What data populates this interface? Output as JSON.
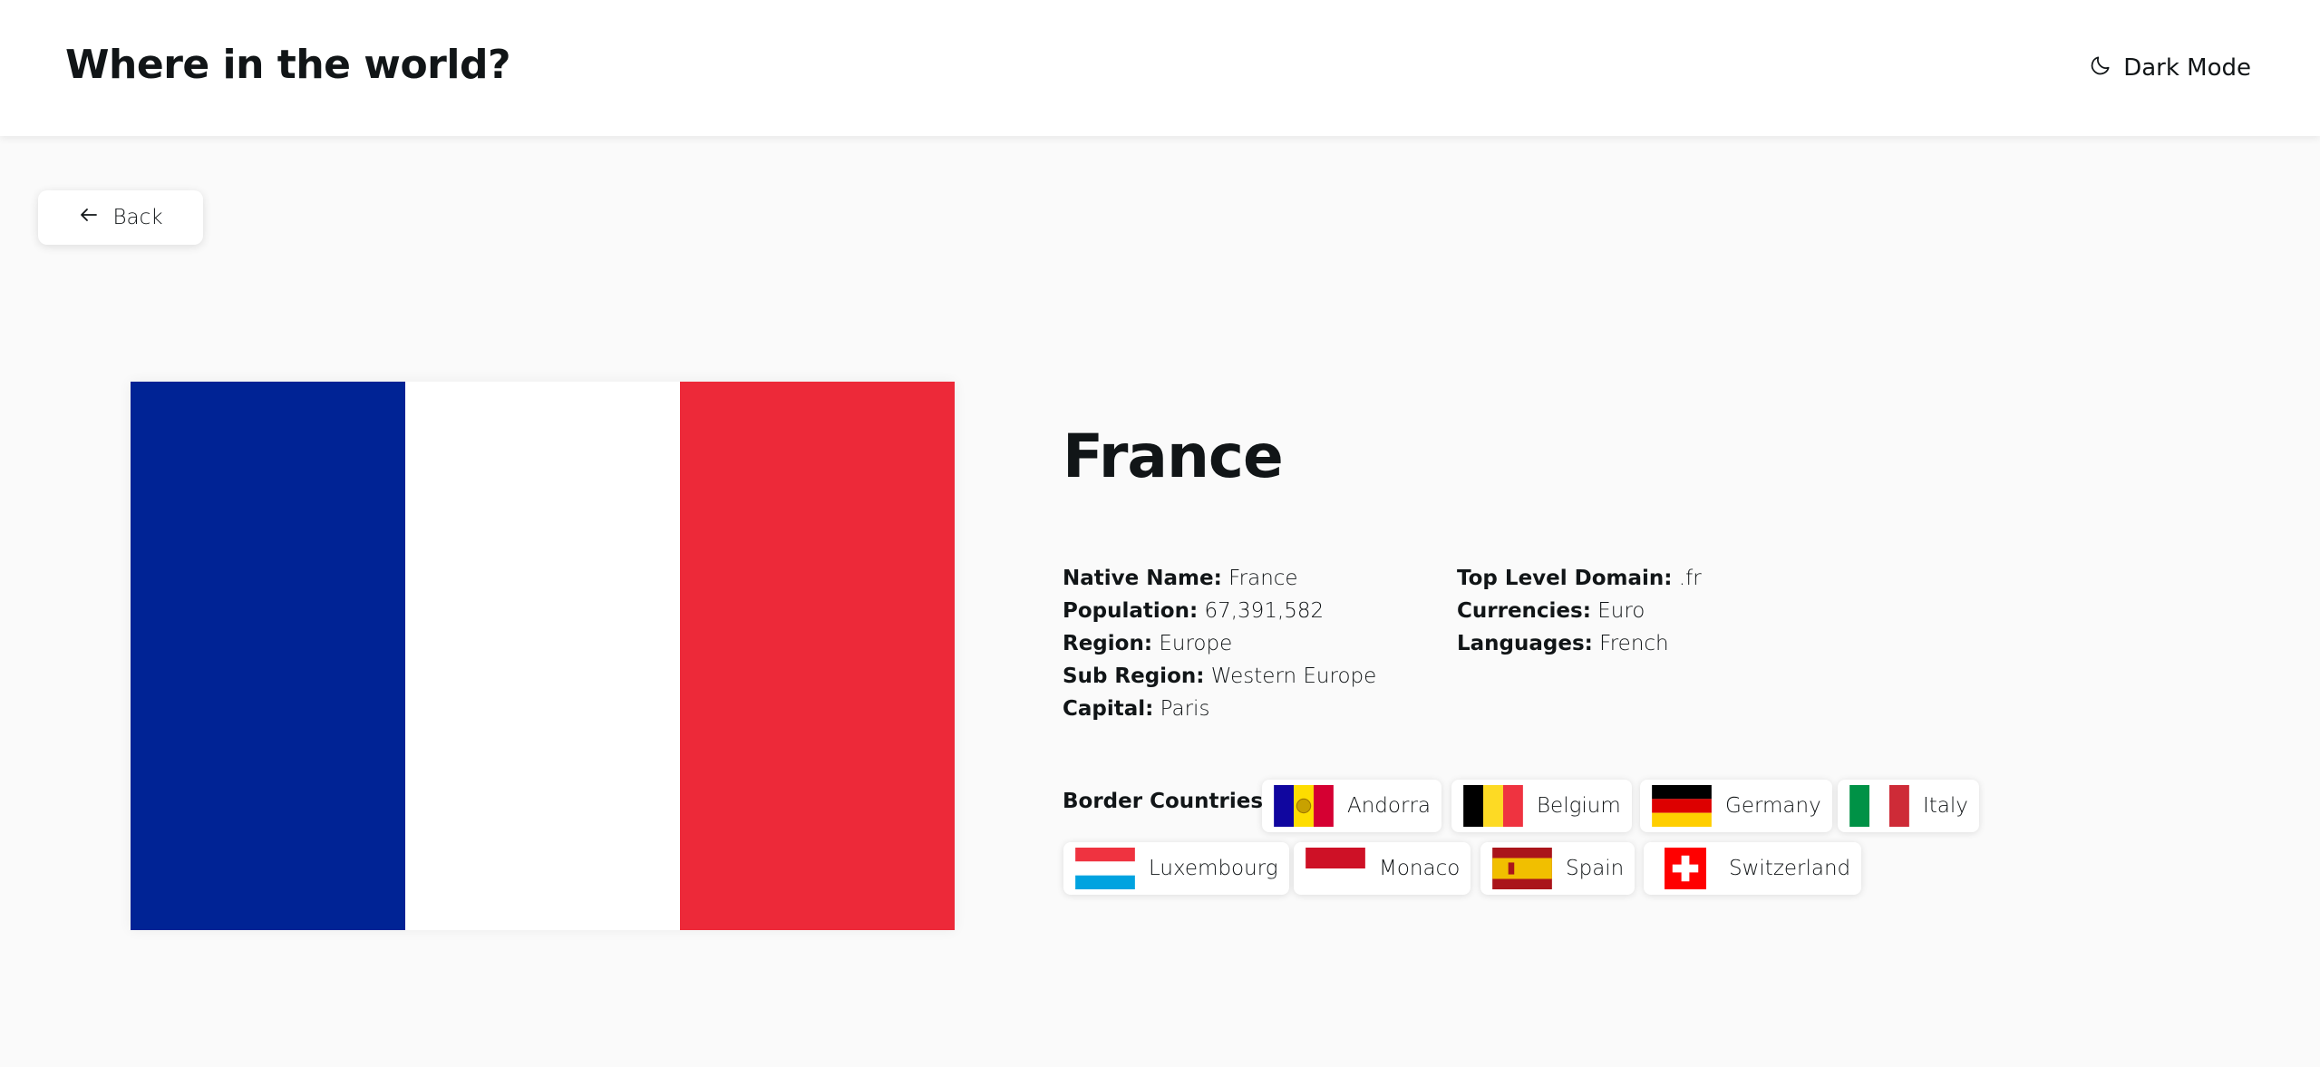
{
  "header": {
    "title": "Where in the world?",
    "theme_toggle_label": "Dark Mode",
    "theme_icon": "moon-icon"
  },
  "back_button": {
    "label": "Back",
    "icon": "arrow-left-icon"
  },
  "country": {
    "name": "France",
    "flag_colors": [
      "#002395",
      "#ffffff",
      "#ED2939"
    ],
    "details_left": [
      {
        "label": "Native Name:",
        "value": "France"
      },
      {
        "label": "Population:",
        "value": "67,391,582"
      },
      {
        "label": "Region:",
        "value": "Europe"
      },
      {
        "label": "Sub Region:",
        "value": "Western Europe"
      },
      {
        "label": "Capital:",
        "value": "Paris"
      }
    ],
    "details_right": [
      {
        "label": "Top Level Domain:",
        "value": ".fr"
      },
      {
        "label": "Currencies:",
        "value": "Euro"
      },
      {
        "label": "Languages:",
        "value": "French"
      }
    ]
  },
  "border_countries": {
    "label": "Border Countries:",
    "items": [
      {
        "name": "Andorra"
      },
      {
        "name": "Belgium"
      },
      {
        "name": "Germany"
      },
      {
        "name": "Italy"
      },
      {
        "name": "Luxembourg"
      },
      {
        "name": "Monaco"
      },
      {
        "name": "Spain"
      },
      {
        "name": "Switzerland"
      }
    ]
  }
}
